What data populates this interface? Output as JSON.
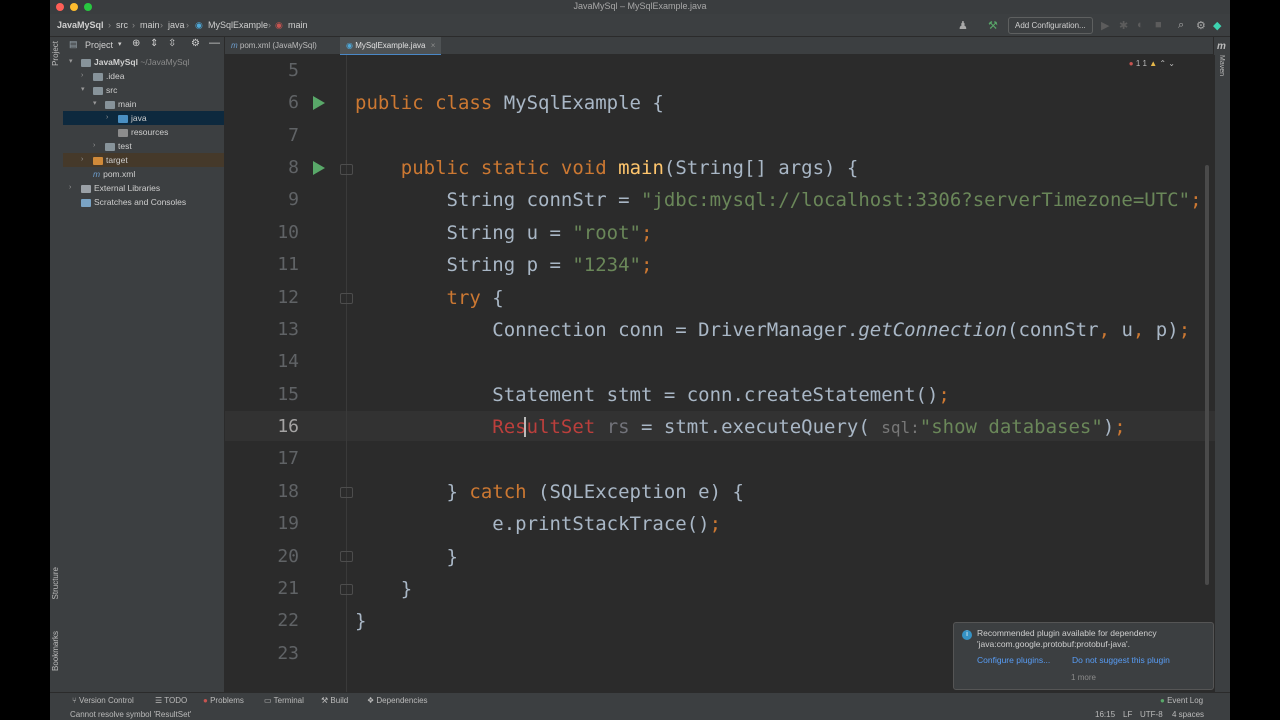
{
  "window": {
    "title": "JavaMySql – MySqlExample.java"
  },
  "breadcrumbs": [
    "JavaMySql",
    "src",
    "main",
    "java",
    "MySqlExample",
    "main"
  ],
  "toolbar": {
    "add_configuration": "Add Configuration..."
  },
  "tool_windows": {
    "project": "Project",
    "structure": "Structure",
    "bookmarks": "Bookmarks",
    "maven": "Maven"
  },
  "project": {
    "header": "Project",
    "tree": [
      {
        "label": "JavaMySql",
        "extra": "~/JavaMySql"
      },
      {
        "label": ".idea"
      },
      {
        "label": "src"
      },
      {
        "label": "main"
      },
      {
        "label": "java"
      },
      {
        "label": "resources"
      },
      {
        "label": "test"
      },
      {
        "label": "target"
      },
      {
        "label": "pom.xml"
      },
      {
        "label": "External Libraries"
      },
      {
        "label": "Scratches and Consoles"
      }
    ]
  },
  "tabs": [
    {
      "label": "pom.xml (JavaMySql)"
    },
    {
      "label": "MySqlExample.java"
    }
  ],
  "editor": {
    "inspections": "1  1",
    "line_numbers": [
      "5",
      "6",
      "7",
      "8",
      "9",
      "10",
      "11",
      "12",
      "13",
      "14",
      "15",
      "16",
      "17",
      "18",
      "19",
      "20",
      "21",
      "22",
      "23"
    ],
    "current_line": "16",
    "param_hint": "sql:"
  },
  "notification": {
    "message": "Recommended plugin available for dependency 'java:com.google.protobuf:protobuf-java'.",
    "action_configure": "Configure plugins...",
    "action_dismiss": "Do not suggest this plugin",
    "more": "1 more"
  },
  "statusbar": {
    "tabs": [
      "Version Control",
      "TODO",
      "Problems",
      "Terminal",
      "Build",
      "Dependencies"
    ],
    "event_log": "Event Log",
    "message": "Cannot resolve symbol 'ResultSet'",
    "position": "16:15",
    "line_sep": "LF",
    "encoding": "UTF-8",
    "indent": "4 spaces"
  },
  "colors": {
    "keyword": "#cc7832",
    "string": "#6a8759",
    "method": "#ffc66d",
    "error": "#bc3f3c",
    "accent": "#4a88c7"
  }
}
